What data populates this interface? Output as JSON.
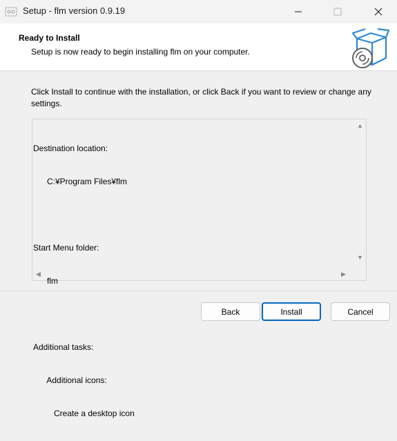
{
  "window": {
    "title": "Setup - flm version 0.9.19",
    "controls": {
      "minimize": "minimize-icon",
      "maximize": "maximize-icon",
      "close": "close-icon"
    }
  },
  "header": {
    "title": "Ready to Install",
    "subtitle": "Setup is now ready to begin installing flm on your computer."
  },
  "body": {
    "intro": "Click Install to continue with the installation, or click Back if you want to review or change any settings.",
    "memo_lines": [
      "Destination location:",
      "      C:¥Program Files¥flm",
      "",
      "Start Menu folder:",
      "      flm",
      "",
      "Additional tasks:",
      "      Additional icons:",
      "         Create a desktop icon"
    ]
  },
  "buttons": {
    "back": "Back",
    "install": "Install",
    "cancel": "Cancel"
  },
  "colors": {
    "accent": "#0067c0",
    "icon_blue": "#2b88d8"
  }
}
